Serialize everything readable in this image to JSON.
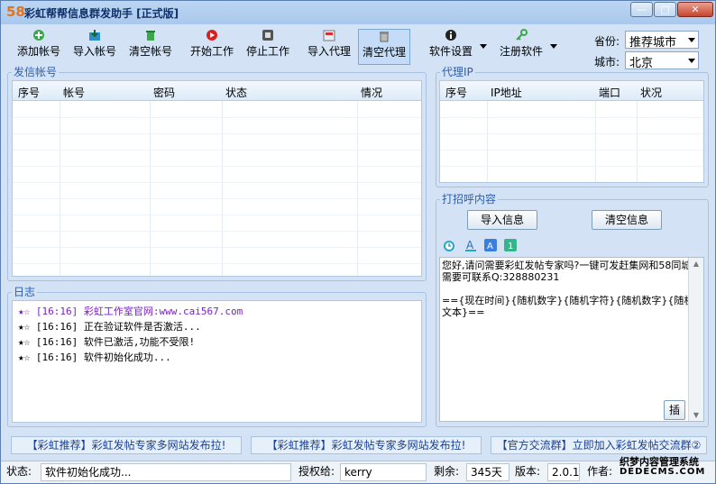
{
  "window": {
    "logo": "58",
    "title": "彩虹帮帮信息群发助手 [正式版]"
  },
  "toolbar": {
    "add_account": "添加帐号",
    "import_account": "导入帐号",
    "clear_account": "清空帐号",
    "start": "开始工作",
    "stop": "停止工作",
    "import_proxy": "导入代理",
    "clear_proxy": "清空代理",
    "settings": "软件设置",
    "register": "注册软件"
  },
  "location": {
    "province_label": "省份:",
    "province_value": "推荐城市",
    "city_label": "城市:",
    "city_value": "北京"
  },
  "accounts": {
    "title": "发信帐号",
    "columns": [
      "序号",
      "帐号",
      "密码",
      "状态",
      "情况"
    ]
  },
  "proxy": {
    "title": "代理IP",
    "columns": [
      "序号",
      "IP地址",
      "端口",
      "状况"
    ]
  },
  "log": {
    "title": "日志",
    "lines": [
      {
        "star": "★☆",
        "time": "[16:16]",
        "text": "彩虹工作室官网:www.cai567.com"
      },
      {
        "star": "★☆",
        "time": "[16:16]",
        "text": "正在验证软件是否激活..."
      },
      {
        "star": "★☆",
        "time": "[16:16]",
        "text": "软件已激活,功能不受限!"
      },
      {
        "star": "★☆",
        "time": "[16:16]",
        "text": "软件初始化成功..."
      }
    ]
  },
  "greeting": {
    "title": "打招呼内容",
    "import_btn": "导入信息",
    "clear_btn": "清空信息",
    "text1": "您好,请问需要彩虹发帖专家吗?一键可发赶集网和58同城,需要可联系Q:328880231",
    "text2": "=={现在时间}{随机数字}{随机字符}{随机数字}{随机文本}==",
    "insert_btn": "插"
  },
  "promos": [
    "【彩虹推荐】彩虹发帖专家多网站发布拉!",
    "【彩虹推荐】彩虹发帖专家多网站发布拉!",
    "【官方交流群】立即加入彩虹发帖交流群②"
  ],
  "status": {
    "state_label": "状态:",
    "state_value": "软件初始化成功...",
    "auth_label": "授权给:",
    "auth_value": "kerry",
    "remain_label": "剩余:",
    "remain_value": "345天",
    "version_label": "版本:",
    "version_value": "2.0.1",
    "author_label": "作者:"
  },
  "watermark": {
    "line1": "织梦内容管理系统",
    "line2": "DEDECMS.COM"
  },
  "colors": {
    "accent": "#2a5fb0",
    "title_text": "#10306a",
    "log_highlight": "#7a1fc4",
    "frame": "#d3e3f5"
  }
}
